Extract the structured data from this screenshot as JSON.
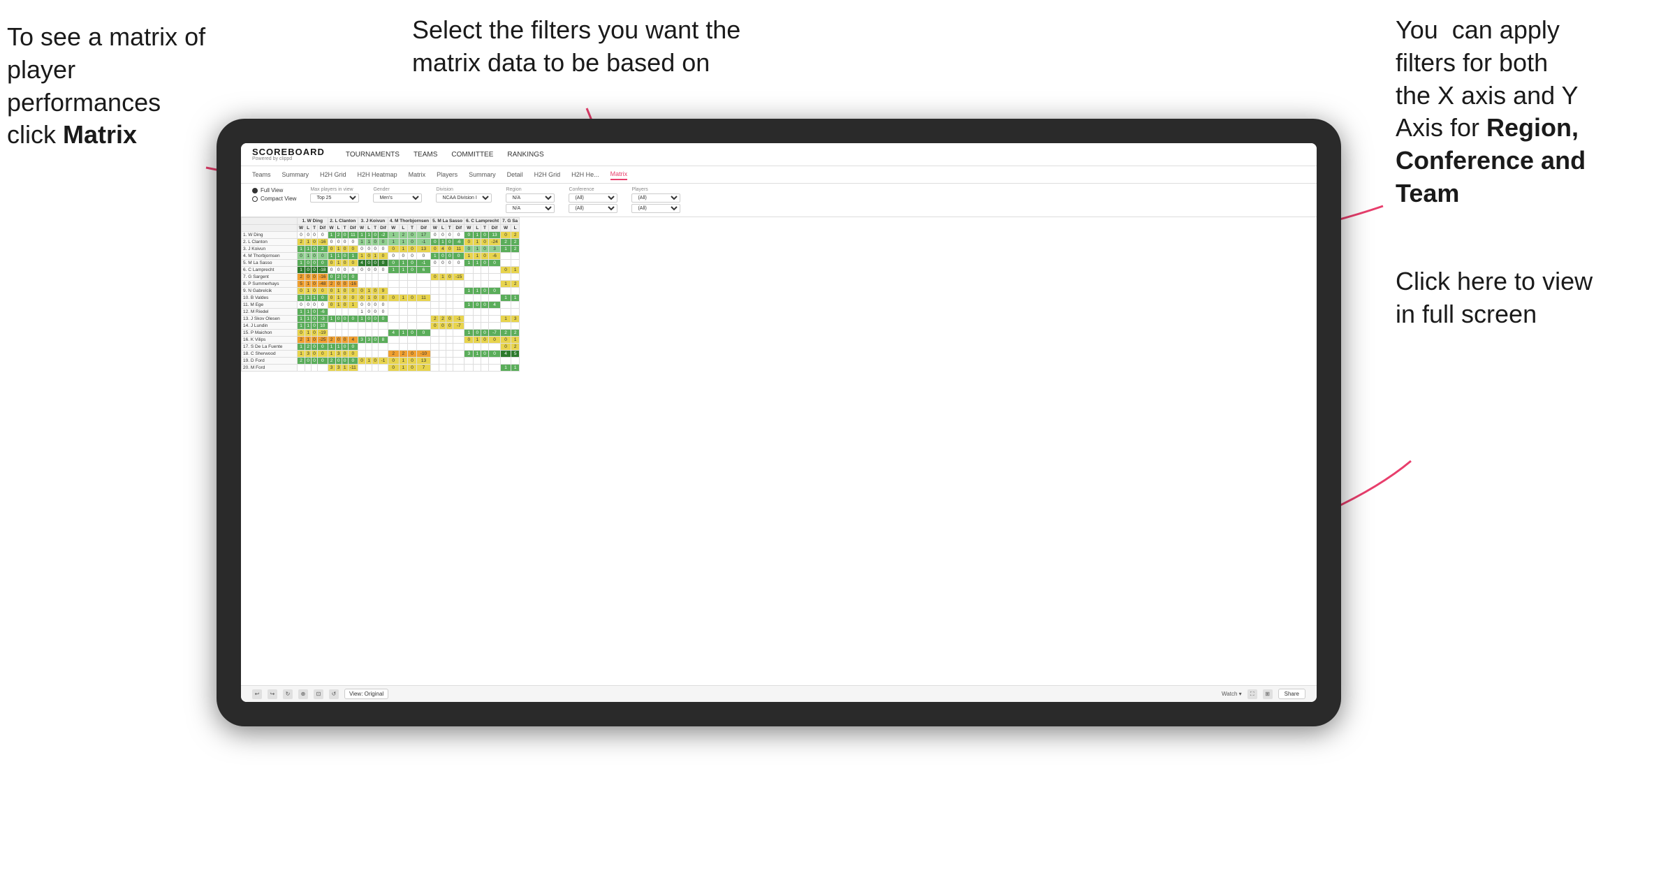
{
  "annotations": {
    "left": {
      "line1": "To see a matrix of",
      "line2": "player performances",
      "line3": "click ",
      "line3_bold": "Matrix"
    },
    "center": {
      "text": "Select the filters you want the matrix data to be based on"
    },
    "right_top": {
      "line1": "You  can apply",
      "line2": "filters for both",
      "line3": "the X axis and Y",
      "line4": "Axis for ",
      "line4_bold": "Region,",
      "line5_bold": "Conference and",
      "line6_bold": "Team"
    },
    "right_bottom": {
      "line1": "Click here to view",
      "line2": "in full screen"
    }
  },
  "nav": {
    "logo": "SCOREBOARD",
    "logo_sub": "Powered by clippd",
    "items": [
      "TOURNAMENTS",
      "TEAMS",
      "COMMITTEE",
      "RANKINGS"
    ]
  },
  "subnav": {
    "items": [
      "Teams",
      "Summary",
      "H2H Grid",
      "H2H Heatmap",
      "Matrix",
      "Players",
      "Summary",
      "Detail",
      "H2H Grid",
      "H2H He...",
      "Matrix"
    ]
  },
  "filters": {
    "view_options": [
      "Full View",
      "Compact View"
    ],
    "max_players": "Top 25",
    "gender": "Men's",
    "division": "NCAA Division I",
    "region_label": "Region",
    "region_val": "N/A",
    "conference_label": "Conference",
    "conference_val1": "(All)",
    "conference_val2": "(All)",
    "players_label": "Players",
    "players_val1": "(All)",
    "players_val2": "(All)"
  },
  "matrix": {
    "col_headers": [
      "1. W Ding",
      "2. L Clanton",
      "3. J Koivun",
      "4. M Thorbjornsen",
      "5. M La Sasso",
      "6. C Lamprecht",
      "7. G Sa"
    ],
    "sub_headers": [
      "W",
      "L",
      "T",
      "Dif"
    ],
    "rows": [
      {
        "name": "1. W Ding",
        "cells": [
          [
            0,
            0,
            0,
            0,
            0
          ],
          [
            1,
            2,
            0,
            11
          ],
          [
            1,
            1,
            0,
            -2
          ],
          [
            1,
            2,
            0,
            17
          ],
          [
            0,
            0,
            0,
            0
          ],
          [
            0,
            1,
            0,
            13
          ],
          [
            0,
            2
          ]
        ]
      },
      {
        "name": "2. L Clanton",
        "cells": [
          [
            2,
            1,
            0,
            -16
          ],
          [
            0,
            0,
            0,
            0
          ],
          [
            1,
            1,
            0,
            0
          ],
          [
            1,
            1,
            0,
            -1
          ],
          [
            0,
            1,
            0,
            -6
          ],
          [
            0,
            1,
            0,
            -24
          ],
          [
            2,
            2
          ]
        ]
      },
      {
        "name": "3. J Koivun",
        "cells": [
          [
            1,
            1,
            0,
            2
          ],
          [
            0,
            1,
            0,
            0
          ],
          [
            0,
            0,
            0,
            0
          ],
          [
            0,
            1,
            0,
            13
          ],
          [
            0,
            4,
            0,
            11
          ],
          [
            0,
            1,
            0,
            3
          ],
          [
            1,
            2
          ]
        ]
      },
      {
        "name": "4. M Thorbjornsen",
        "cells": [
          [
            0,
            1,
            0,
            0
          ],
          [
            1,
            1,
            0,
            1
          ],
          [
            1,
            0,
            1,
            0
          ],
          [
            0,
            0,
            0,
            0
          ],
          [
            1,
            0,
            0,
            0
          ],
          [
            1,
            1,
            0,
            -6
          ],
          []
        ]
      },
      {
        "name": "5. M La Sasso",
        "cells": [
          [
            1,
            0,
            0,
            0
          ],
          [
            0,
            1,
            0,
            0
          ],
          [
            4,
            0,
            0,
            0
          ],
          [
            0,
            1,
            0,
            -1
          ],
          [
            0,
            0,
            0,
            0
          ],
          [
            1,
            1,
            0,
            0
          ],
          []
        ]
      },
      {
        "name": "6. C Lamprecht",
        "cells": [
          [
            1,
            0,
            0,
            -18
          ],
          [
            0,
            0,
            0,
            0
          ],
          [
            0,
            0,
            0,
            0
          ],
          [
            1,
            1,
            0,
            6
          ],
          [],
          [],
          [
            0,
            1
          ]
        ]
      },
      {
        "name": "7. G Sargent",
        "cells": [
          [
            2,
            0,
            0,
            -16
          ],
          [
            0,
            2,
            0,
            0
          ],
          [],
          [],
          [
            0,
            1,
            0,
            -15
          ],
          [],
          []
        ]
      },
      {
        "name": "8. P Summerhays",
        "cells": [
          [
            5,
            1,
            0,
            -48
          ],
          [
            2,
            0,
            0,
            -16
          ],
          [],
          [],
          [],
          [],
          [
            1,
            2
          ]
        ]
      },
      {
        "name": "9. N Gabrelcik",
        "cells": [
          [
            0,
            1,
            0,
            0
          ],
          [
            0,
            1,
            0,
            0
          ],
          [
            0,
            1,
            0,
            9
          ],
          [],
          [],
          [
            1,
            1,
            0,
            0
          ],
          []
        ]
      },
      {
        "name": "10. B Valdes",
        "cells": [
          [
            1,
            1,
            1,
            0
          ],
          [
            0,
            1,
            0,
            0
          ],
          [
            0,
            1,
            0,
            0
          ],
          [
            0,
            1,
            0,
            11
          ],
          [],
          [],
          [
            1,
            1
          ]
        ]
      },
      {
        "name": "11. M Ege",
        "cells": [
          [
            0,
            0,
            0,
            0
          ],
          [
            0,
            1,
            0,
            1
          ],
          [
            0,
            0,
            0,
            0
          ],
          [],
          [],
          [
            1,
            0,
            0,
            4
          ],
          []
        ]
      },
      {
        "name": "12. M Riedel",
        "cells": [
          [
            1,
            1,
            0,
            -6
          ],
          [],
          [
            1,
            0,
            0,
            0
          ],
          [],
          [],
          [],
          []
        ]
      },
      {
        "name": "13. J Skov Olesen",
        "cells": [
          [
            1,
            1,
            0,
            -3
          ],
          [
            1,
            0,
            0,
            0
          ],
          [
            1,
            0,
            0,
            0
          ],
          [],
          [
            2,
            2,
            0,
            -1
          ],
          [],
          [
            1,
            3
          ]
        ]
      },
      {
        "name": "14. J Lundin",
        "cells": [
          [
            1,
            1,
            0,
            10
          ],
          [],
          [],
          [],
          [
            0,
            0,
            0,
            -7
          ],
          [],
          []
        ]
      },
      {
        "name": "15. P Maichon",
        "cells": [
          [
            0,
            1,
            0,
            -19
          ],
          [],
          [],
          [
            4,
            1,
            0,
            0
          ],
          [],
          [
            1,
            0,
            0,
            -7
          ],
          [
            2,
            2
          ]
        ]
      },
      {
        "name": "16. K Vilips",
        "cells": [
          [
            2,
            1,
            0,
            -25
          ],
          [
            2,
            0,
            0,
            4
          ],
          [
            3,
            3,
            0,
            8
          ],
          [],
          [],
          [
            0,
            1,
            0,
            0
          ],
          [
            0,
            1
          ]
        ]
      },
      {
        "name": "17. S De La Fuente",
        "cells": [
          [
            1,
            2,
            0,
            0
          ],
          [
            1,
            1,
            0,
            0
          ],
          [],
          [],
          [],
          [],
          [
            0,
            2
          ]
        ]
      },
      {
        "name": "18. C Sherwood",
        "cells": [
          [
            1,
            3,
            0,
            0
          ],
          [
            1,
            3,
            0,
            0
          ],
          [],
          [
            2,
            2,
            0,
            -10
          ],
          [],
          [
            3,
            1,
            0,
            0
          ],
          [
            4,
            5
          ]
        ]
      },
      {
        "name": "19. D Ford",
        "cells": [
          [
            2,
            0,
            0,
            0
          ],
          [
            2,
            0,
            0,
            0
          ],
          [
            0,
            1,
            0,
            -1
          ],
          [
            0,
            1,
            0,
            13
          ],
          [],
          [],
          []
        ]
      },
      {
        "name": "20. M Ford",
        "cells": [
          [],
          [
            3,
            3,
            1,
            -11
          ],
          [],
          [
            0,
            1,
            0,
            7
          ],
          [],
          [],
          [
            1,
            1
          ]
        ]
      }
    ]
  },
  "toolbar": {
    "view_label": "View: Original",
    "watch_label": "Watch ▾",
    "share_label": "Share"
  },
  "colors": {
    "accent": "#e83e6c",
    "green_dark": "#2d7a2d",
    "green": "#5aad5a",
    "yellow": "#e8d44d",
    "orange": "#f0a030"
  }
}
